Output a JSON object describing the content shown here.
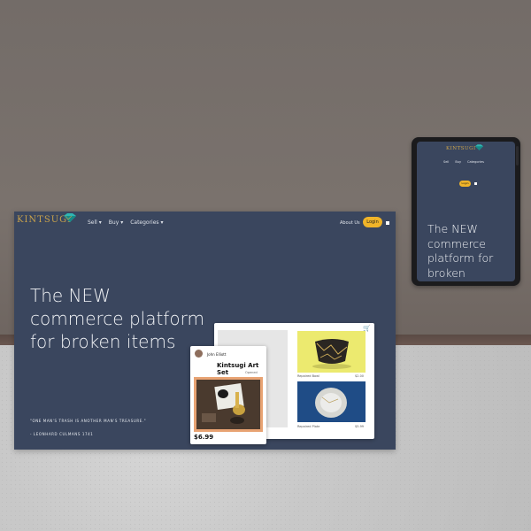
{
  "brand": {
    "name": "KINTSUGI",
    "logo_icon": "gem-icon",
    "accent": "#f0b429",
    "panel_color": "#3a465e"
  },
  "nav": {
    "sell": "Sell",
    "buy": "Buy",
    "categories": "Categories",
    "about": "About Us",
    "login": "Login"
  },
  "hero": {
    "headline": "The NEW commerce platform for broken items"
  },
  "quote": {
    "text": "\"ONE MAN'S TRASH IS ANOTHER MAN'S TREASURE.\"",
    "cite": "- LEONHARD CULMANS 1741"
  },
  "listings": [
    {
      "name": "Repaired Bowl",
      "price": "$2.00"
    },
    {
      "name": "Repaired Plate",
      "price": "$5.99"
    }
  ],
  "featured": {
    "user": "John Elliott",
    "title": "Kintsugi Art Set",
    "status": "Opened",
    "price": "$6.99"
  },
  "tablet": {
    "headline": "The NEW commerce platform for broken"
  }
}
